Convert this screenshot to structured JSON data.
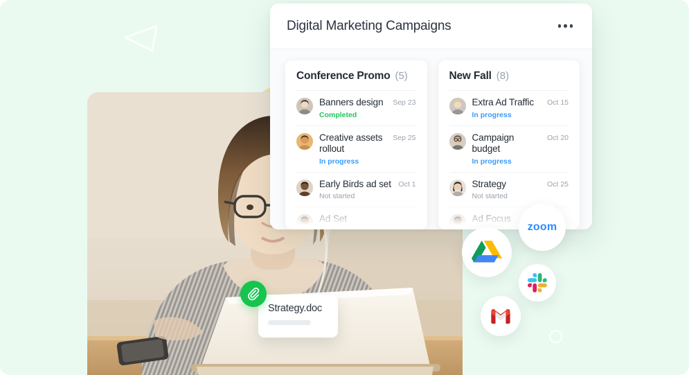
{
  "background": {
    "color": "#eafaf1",
    "decorations": [
      "triangle-outline",
      "yellow-brush-stroke",
      "circle-outline"
    ]
  },
  "photo": {
    "alt": "Woman with glasses working on a laptop at a desk",
    "accent": "#e8ded1"
  },
  "panel": {
    "title": "Digital Marketing Campaigns",
    "menu_label": "•••",
    "cards": [
      {
        "name": "Conference Promo",
        "count": "(5)",
        "tasks": [
          {
            "avatar": "woman-dark-hair",
            "title": "Banners design",
            "date": "Sep 23",
            "status": "Completed",
            "status_key": "completed"
          },
          {
            "avatar": "man-tan",
            "title": "Creative assets rollout",
            "date": "Sep 25",
            "status": "In progress",
            "status_key": "inprogress"
          },
          {
            "avatar": "man-dark",
            "title": "Early Birds ad set",
            "date": "Oct 1",
            "status": "Not started",
            "status_key": "notstarted"
          },
          {
            "avatar": "person-partial",
            "title": "Ad Set",
            "date": "",
            "status": "",
            "status_key": "notstarted"
          }
        ]
      },
      {
        "name": "New Fall",
        "count": "(8)",
        "tasks": [
          {
            "avatar": "woman-blonde",
            "title": "Extra Ad Traffic",
            "date": "Oct 15",
            "status": "In progress",
            "status_key": "inprogress"
          },
          {
            "avatar": "man-glasses",
            "title": "Campaign budget",
            "date": "Oct 20",
            "status": "In progress",
            "status_key": "inprogress"
          },
          {
            "avatar": "woman-brunette",
            "title": "Strategy",
            "date": "Oct 25",
            "status": "Not started",
            "status_key": "notstarted"
          },
          {
            "avatar": "person-partial",
            "title": "Ad Focus",
            "date": "",
            "status": "",
            "status_key": "notstarted"
          }
        ]
      }
    ]
  },
  "file_chip": {
    "name": "Strategy.doc",
    "icon": "paperclip-icon",
    "badge_color": "#16c44e"
  },
  "integrations": [
    {
      "key": "zoom",
      "label": "zoom",
      "color": "#2d8cff"
    },
    {
      "key": "drive",
      "label": "Google Drive",
      "color": "#0f9d58"
    },
    {
      "key": "slack",
      "label": "Slack",
      "color": "#e01e5a"
    },
    {
      "key": "gmail",
      "label": "Gmail",
      "color": "#ea4335"
    }
  ],
  "status_colors": {
    "completed": "#22c55e",
    "inprogress": "#3b9bfb",
    "notstarted": "#98a1ab"
  }
}
